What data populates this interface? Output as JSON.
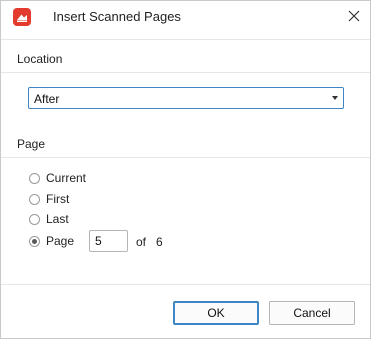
{
  "window": {
    "title": "Insert Scanned Pages",
    "app_icon": "scanner-app-icon",
    "close_icon": "close-icon",
    "accent_color": "#3d85c6",
    "icon_color": "#e43b2f"
  },
  "location": {
    "label": "Location",
    "selected": "After"
  },
  "page": {
    "label": "Page",
    "options": [
      {
        "label": "Current",
        "checked": false
      },
      {
        "label": "First",
        "checked": false
      },
      {
        "label": "Last",
        "checked": false
      },
      {
        "label": "Page",
        "checked": true
      }
    ],
    "page_number": "5",
    "of_label": "of",
    "total_pages": "6"
  },
  "buttons": {
    "ok": "OK",
    "cancel": "Cancel"
  }
}
